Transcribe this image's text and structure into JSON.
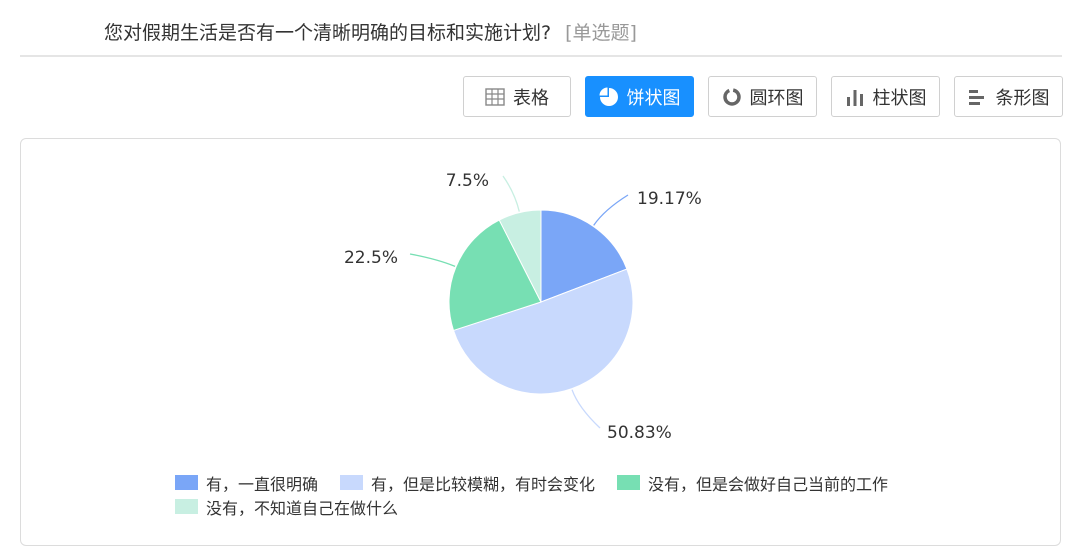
{
  "question": {
    "title": "您对假期生活是否有一个清晰明确的目标和实施计划?",
    "type": "[单选题]"
  },
  "toolbar": [
    {
      "label": "表格",
      "icon": "table-icon",
      "active": false
    },
    {
      "label": "饼状图",
      "icon": "pie-chart-icon",
      "active": true
    },
    {
      "label": "圆环图",
      "icon": "donut-chart-icon",
      "active": false
    },
    {
      "label": "柱状图",
      "icon": "bar-chart-icon",
      "active": false
    },
    {
      "label": "条形图",
      "icon": "horizontal-bar-chart-icon",
      "active": false
    }
  ],
  "chart_data": {
    "type": "pie",
    "slices": [
      {
        "name": "有，一直很明确",
        "value": 19.17,
        "label": "19.17%",
        "color": "#7aa6f7"
      },
      {
        "name": "有，但是比较模糊，有时会变化",
        "value": 50.83,
        "label": "50.83%",
        "color": "#c8d9fd"
      },
      {
        "name": "没有，但是会做好自己当前的工作",
        "value": 22.5,
        "label": "22.5%",
        "color": "#77dfb3"
      },
      {
        "name": "没有，不知道自己在做什么",
        "value": 7.5,
        "label": "7.5%",
        "color": "#c8efe2"
      }
    ],
    "legend_position": "bottom"
  }
}
